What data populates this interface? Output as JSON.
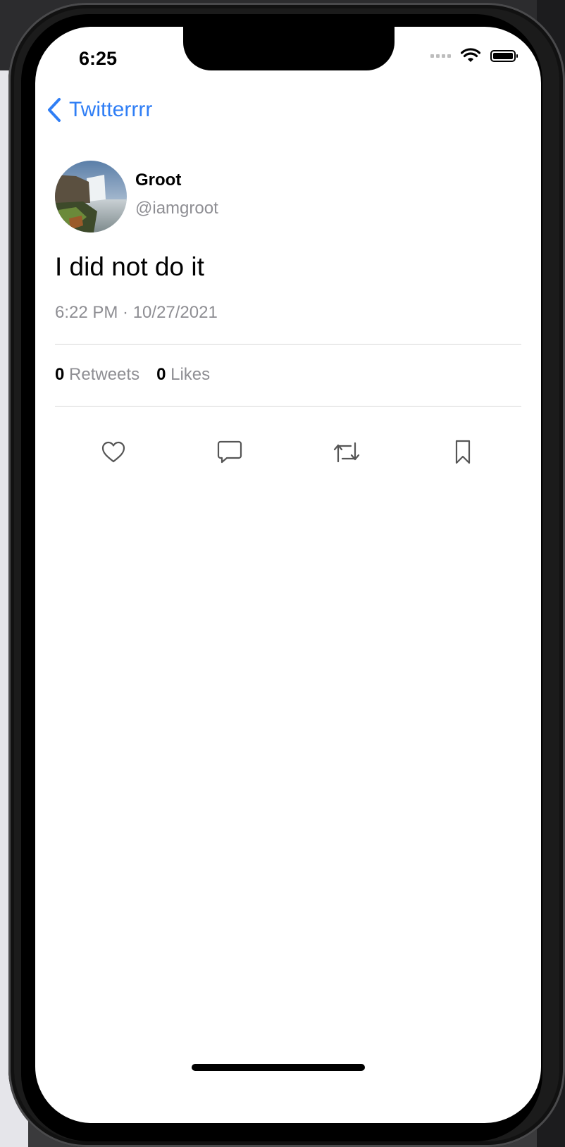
{
  "status_bar": {
    "time": "6:25"
  },
  "nav": {
    "back_label": "Twitterrrr"
  },
  "tweet": {
    "author_name": "Groot",
    "author_handle": "@iamgroot",
    "text": "I did not do it",
    "timestamp": "6:22 PM · 10/27/2021",
    "retweets_count": "0",
    "retweets_label": "Retweets",
    "likes_count": "0",
    "likes_label": "Likes"
  },
  "actions": {
    "icons": [
      "heart-icon",
      "comment-icon",
      "retweet-icon",
      "bookmark-icon"
    ]
  },
  "colors": {
    "accent": "#2f7ef5",
    "secondary_text": "#8e8e93",
    "divider": "#d8d8d8"
  }
}
